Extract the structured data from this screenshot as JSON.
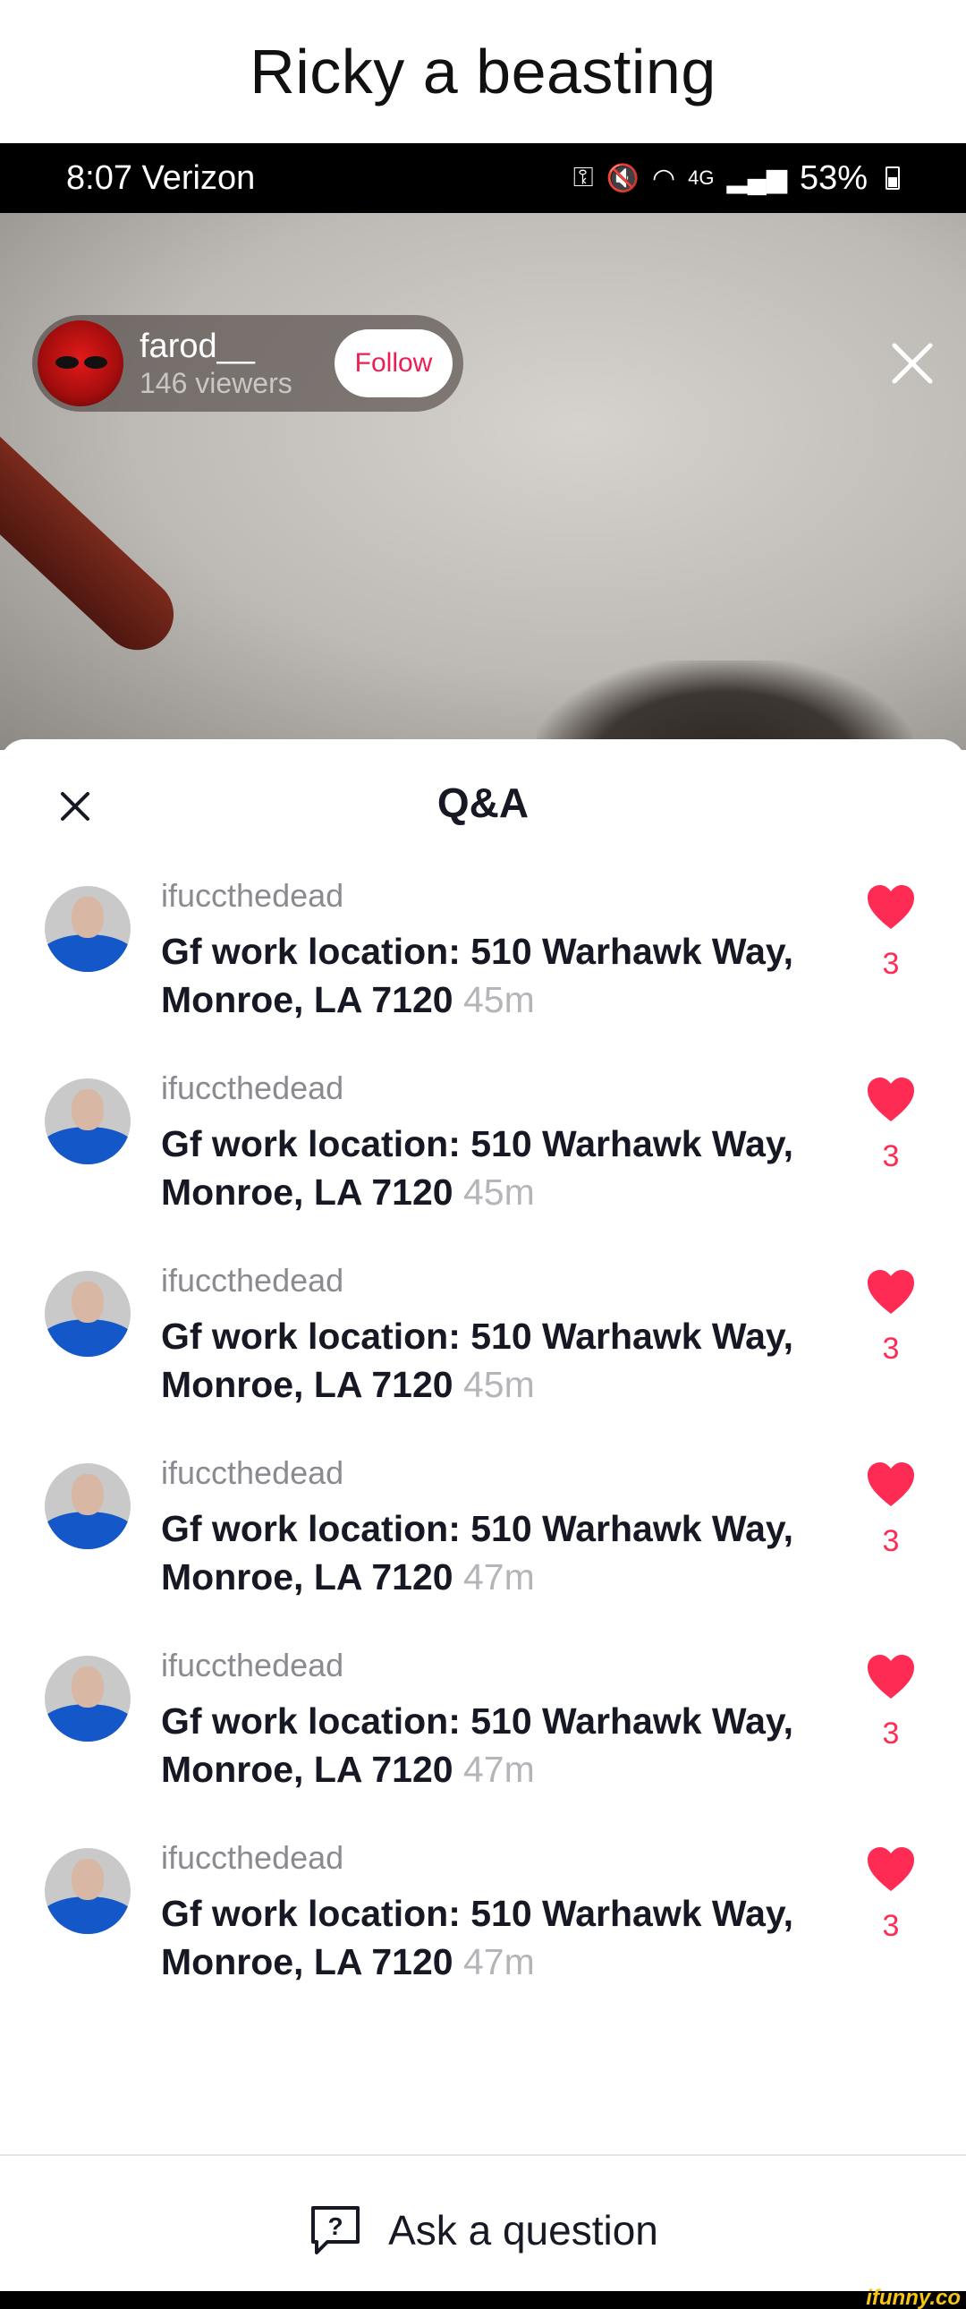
{
  "caption": "Ricky a beasting",
  "status_bar": {
    "time_carrier": "8:07 Verizon",
    "network": "4G",
    "battery": "53%"
  },
  "live": {
    "host_name": "farod__",
    "viewers": "146 viewers",
    "follow_label": "Follow"
  },
  "qa": {
    "title": "Q&A",
    "items": [
      {
        "user": "ifuccthedead",
        "text": "Gf work location: 510 Warhawk Way, Monroe, LA 7120",
        "time": "45m",
        "likes": "3"
      },
      {
        "user": "ifuccthedead",
        "text": "Gf work location: 510 Warhawk Way, Monroe, LA 7120",
        "time": "45m",
        "likes": "3"
      },
      {
        "user": "ifuccthedead",
        "text": "Gf work location: 510 Warhawk Way, Monroe, LA 7120",
        "time": "45m",
        "likes": "3"
      },
      {
        "user": "ifuccthedead",
        "text": "Gf work location: 510 Warhawk Way, Monroe, LA 7120",
        "time": "47m",
        "likes": "3"
      },
      {
        "user": "ifuccthedead",
        "text": "Gf work location: 510 Warhawk Way, Monroe, LA 7120",
        "time": "47m",
        "likes": "3"
      },
      {
        "user": "ifuccthedead",
        "text": "Gf work location: 510 Warhawk Way, Monroe, LA 7120",
        "time": "47m",
        "likes": "3"
      }
    ],
    "ask_label": "Ask a question"
  },
  "watermark": "ifunny.co",
  "colors": {
    "accent": "#fe2c55",
    "follow_text": "#ee1d52"
  },
  "icons": {
    "video_close": "close-icon",
    "sheet_close": "close-icon",
    "like": "heart-icon",
    "ask": "question-bubble-icon",
    "nav_back": "chevron-left-icon",
    "nav_home": "home-square-icon",
    "nav_recents": "recents-icon"
  }
}
